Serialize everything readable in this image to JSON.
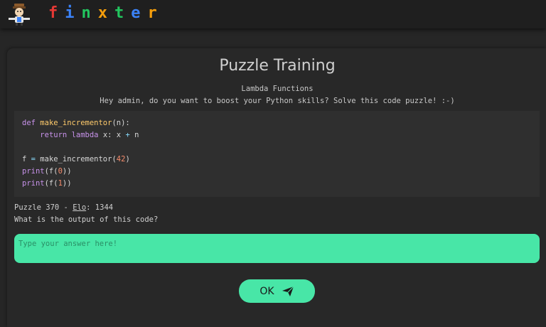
{
  "header": {
    "brand_letters": [
      {
        "char": "f",
        "color": "#e53935"
      },
      {
        "char": "i",
        "color": "#3b82f6"
      },
      {
        "char": "n",
        "color": "#22c55e"
      },
      {
        "char": "x",
        "color": "#f59e0b"
      },
      {
        "char": "t",
        "color": "#22c55e"
      },
      {
        "char": "e",
        "color": "#3b82f6"
      },
      {
        "char": "r",
        "color": "#f59e0b"
      }
    ],
    "logo_icon": "finxter-mascot-icon"
  },
  "main": {
    "title": "Puzzle Training",
    "topic": "Lambda Functions",
    "intro": "Hey admin, do you want to boost your Python skills? Solve this code puzzle! :-)",
    "code_lines": [
      "def make_incrementor(n):",
      "    return lambda x: x + n",
      "",
      "f = make_incrementor(42)",
      "print(f(0))",
      "print(f(1))"
    ],
    "puzzle_label": "Puzzle 370 - ",
    "elo_label": "Elo",
    "elo_value": ": 1344",
    "question": "What is the output of this code?",
    "answer_placeholder": "Type your answer here!",
    "answer_value": "",
    "submit_label": "OK",
    "submit_icon": "paper-plane-icon"
  },
  "colors": {
    "accent": "#48e6a7",
    "background": "#262626"
  }
}
